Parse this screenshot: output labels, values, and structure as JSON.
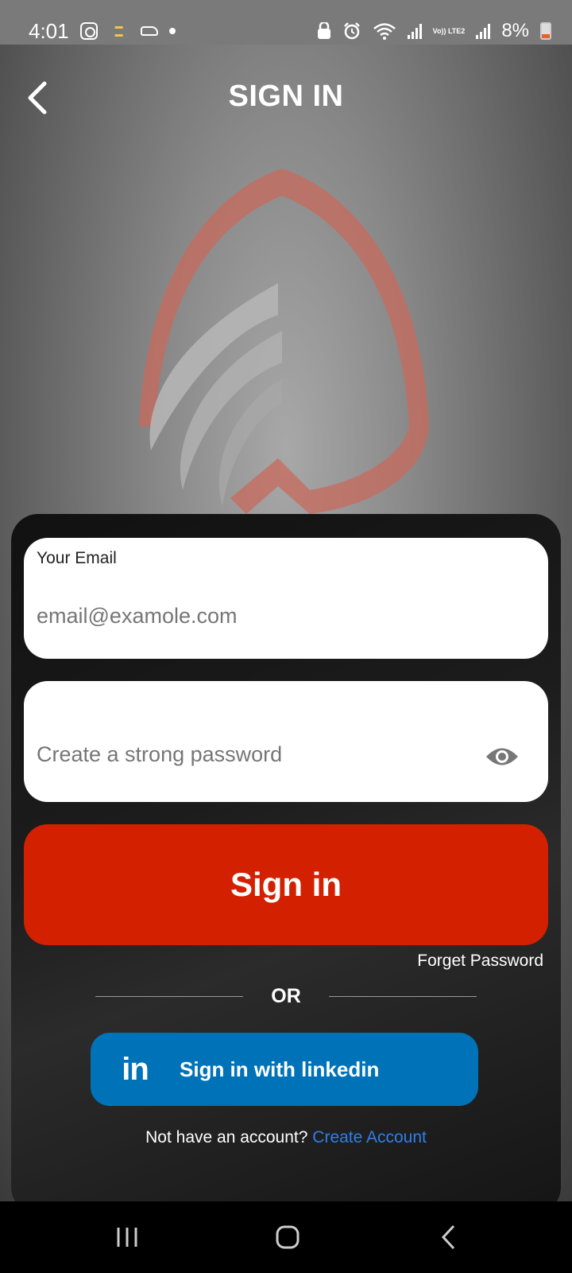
{
  "status_bar": {
    "time": "4:01",
    "battery": "8%",
    "volte": "Vo)) LTE2"
  },
  "header": {
    "title": "SIGN IN"
  },
  "form": {
    "email_label": "Your Email",
    "email_placeholder": "email@examole.com",
    "email_value": "",
    "password_placeholder": "Create a strong password",
    "password_value": "",
    "signin_label": "Sign in",
    "forget_password": "Forget Password",
    "or_text": "OR",
    "linkedin_label": "Sign in with linkedin",
    "linkedin_icon_text": "in",
    "no_account_text": "Not have an account?",
    "create_account_link": "Create Account"
  },
  "colors": {
    "accent_red": "#d32000",
    "linkedin_blue": "#0073b8",
    "link_blue": "#2f7fe8"
  },
  "icons": [
    "instagram-icon",
    "souq-app-icon",
    "car-icon",
    "wifi-icon",
    "alarm-icon",
    "eye-icon",
    "linkedin-icon",
    "back-arrow-icon"
  ]
}
